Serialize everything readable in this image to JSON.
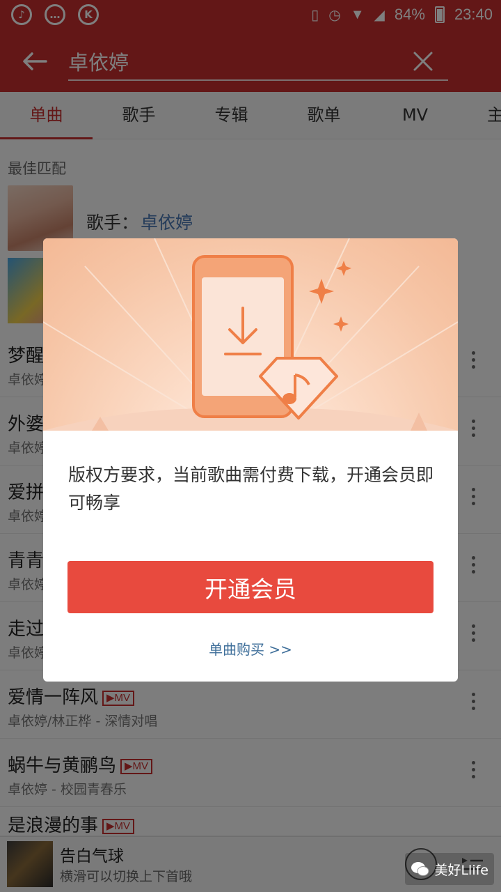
{
  "status_bar": {
    "left_icons": [
      "netease-music-icon",
      "chat-bubble-icon",
      "k-app-icon"
    ],
    "battery": "84%",
    "time": "23:40"
  },
  "search": {
    "query": "卓依婷"
  },
  "tabs": [
    {
      "label": "单曲",
      "active": true
    },
    {
      "label": "歌手",
      "active": false
    },
    {
      "label": "专辑",
      "active": false
    },
    {
      "label": "歌单",
      "active": false
    },
    {
      "label": "MV",
      "active": false
    },
    {
      "label": "主",
      "active": false
    }
  ],
  "best_match": {
    "title": "最佳匹配",
    "artist_label": "歌手：",
    "artist_name": "卓依婷"
  },
  "songs": [
    {
      "title": "梦醒",
      "subtitle": "卓依婷"
    },
    {
      "title": "外婆",
      "subtitle": "卓依婷"
    },
    {
      "title": "爱拼",
      "subtitle": "卓依婷"
    },
    {
      "title": "青青",
      "subtitle": "卓依婷"
    },
    {
      "title": "走过",
      "subtitle": "卓依婷"
    },
    {
      "title": "爱情一阵风",
      "subtitle": "卓依婷/林正桦 - 深情对唱",
      "mv": "▶MV"
    },
    {
      "title": "蜗牛与黄鹂鸟",
      "subtitle": "卓依婷 - 校园青春乐",
      "mv": "▶MV"
    },
    {
      "title": "是浪漫的事",
      "subtitle": "",
      "mv": "▶MV"
    }
  ],
  "dialog": {
    "message": "版权方要求，当前歌曲需付费下载，开通会员即可畅享",
    "primary_button": "开通会员",
    "secondary_link": "单曲购买 >>"
  },
  "player": {
    "title": "告白气球",
    "hint": "横滑可以切换上下首哦"
  },
  "watermark": {
    "text": "美好Llife"
  },
  "colors": {
    "brand_red": "#c62f2f",
    "button_red": "#e84a3e",
    "link_blue": "#3f6f9a",
    "artist_blue": "#4a79b5"
  }
}
